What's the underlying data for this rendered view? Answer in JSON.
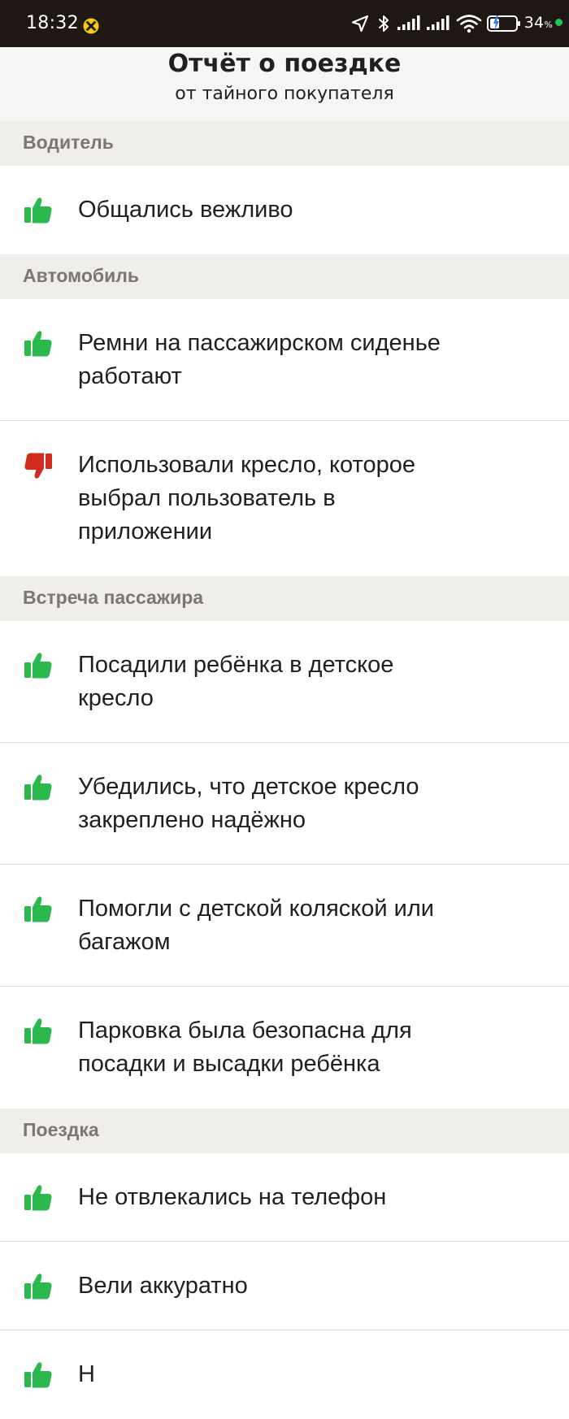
{
  "status_bar": {
    "time": "18:32",
    "battery_percent": "34",
    "battery_unit": "%",
    "app_icon": "taxi-notification-icon",
    "icons": [
      "location-arrow-icon",
      "bluetooth-icon",
      "signal-icon",
      "signal-icon",
      "wifi-icon",
      "battery-icon"
    ]
  },
  "header": {
    "title": "Отчёт о поездке",
    "subtitle": "от тайного покупателя"
  },
  "colors": {
    "positive": "#2bb84c",
    "negative": "#d22a1e",
    "status_bar": "#1e1714",
    "section_bg": "#efeeeb",
    "section_text": "#7b7772"
  },
  "sections": [
    {
      "title": "Водитель",
      "items": [
        {
          "icon": "thumbs-up-icon",
          "verdict": "positive",
          "lines": [
            "Общались вежливо"
          ]
        }
      ]
    },
    {
      "title": "Автомобиль",
      "items": [
        {
          "icon": "thumbs-up-icon",
          "verdict": "positive",
          "lines": [
            "Ремни на пассажирском сиденье",
            "работают"
          ]
        },
        {
          "icon": "thumbs-down-icon",
          "verdict": "negative",
          "lines": [
            "Использовали кресло, которое",
            "выбрал пользователь в",
            "приложении"
          ]
        }
      ]
    },
    {
      "title": "Встреча пассажира",
      "items": [
        {
          "icon": "thumbs-up-icon",
          "verdict": "positive",
          "lines": [
            "Посадили ребёнка в детское",
            "кресло"
          ]
        },
        {
          "icon": "thumbs-up-icon",
          "verdict": "positive",
          "lines": [
            "Убедились, что детское кресло",
            "закреплено надёжно"
          ]
        },
        {
          "icon": "thumbs-up-icon",
          "verdict": "positive",
          "lines": [
            "Помогли с детской коляской или",
            "багажом"
          ]
        },
        {
          "icon": "thumbs-up-icon",
          "verdict": "positive",
          "lines": [
            "Парковка была безопасна для",
            "посадки и высадки ребёнка"
          ]
        }
      ]
    },
    {
      "title": "Поездка",
      "items": [
        {
          "icon": "thumbs-up-icon",
          "verdict": "positive",
          "lines": [
            "Не отвлекались на телефон"
          ]
        },
        {
          "icon": "thumbs-up-icon",
          "verdict": "positive",
          "lines": [
            "Вели аккуратно"
          ]
        },
        {
          "icon": "thumbs-up-icon",
          "verdict": "positive",
          "lines": [
            "Н"
          ]
        }
      ]
    }
  ]
}
